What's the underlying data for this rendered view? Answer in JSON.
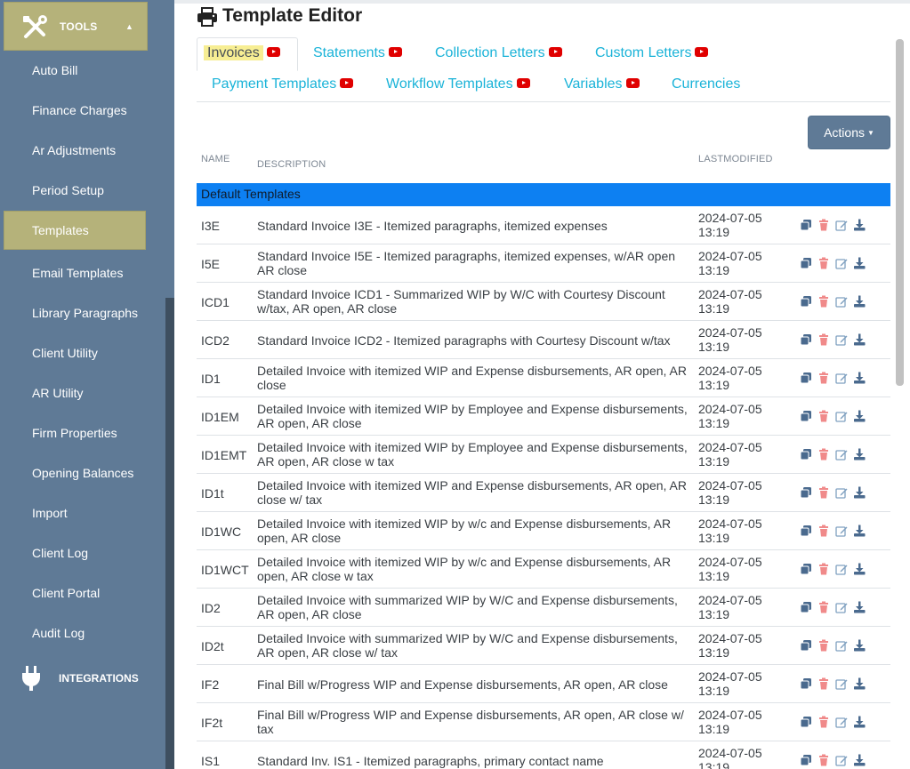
{
  "sidebar": {
    "tools_label": "TOOLS",
    "items": [
      {
        "label": "Auto Bill"
      },
      {
        "label": "Finance Charges"
      },
      {
        "label": "Ar Adjustments"
      },
      {
        "label": "Period Setup"
      },
      {
        "label": "Templates",
        "active": true
      },
      {
        "label": "Email Templates"
      },
      {
        "label": "Library Paragraphs"
      },
      {
        "label": "Client Utility"
      },
      {
        "label": "AR Utility"
      },
      {
        "label": "Firm Properties"
      },
      {
        "label": "Opening Balances"
      },
      {
        "label": "Import"
      },
      {
        "label": "Client Log"
      },
      {
        "label": "Client Portal"
      },
      {
        "label": "Audit Log"
      }
    ],
    "integrations_label": "INTEGRATIONS"
  },
  "page": {
    "title": "Template Editor"
  },
  "tabs": [
    {
      "label": "Invoices",
      "video": true,
      "active": true
    },
    {
      "label": "Statements",
      "video": true
    },
    {
      "label": "Collection Letters",
      "video": true
    },
    {
      "label": "Custom Letters",
      "video": true
    },
    {
      "label": "Payment Templates",
      "video": true
    },
    {
      "label": "Workflow Templates",
      "video": true
    },
    {
      "label": "Variables",
      "video": true
    },
    {
      "label": "Currencies",
      "video": false
    }
  ],
  "actions_label": "Actions",
  "table": {
    "headers": {
      "name": "NAME",
      "description": "DESCRIPTION",
      "modified": "LASTMODIFIED"
    },
    "group_label": "Default Templates",
    "rows": [
      {
        "name": "I3E",
        "description": "Standard Invoice I3E - Itemized paragraphs, itemized expenses",
        "date": "2024-07-05",
        "time": "13:19"
      },
      {
        "name": "I5E",
        "description": "Standard Invoice I5E - Itemized paragraphs, itemized expenses, w/AR open AR close",
        "date": "2024-07-05",
        "time": "13:19"
      },
      {
        "name": "ICD1",
        "description": "Standard Invoice ICD1 - Summarized WIP by W/C with Courtesy Discount w/tax, AR open, AR close",
        "date": "2024-07-05",
        "time": "13:19"
      },
      {
        "name": "ICD2",
        "description": "Standard Invoice ICD2 - Itemized paragraphs with Courtesy Discount w/tax",
        "date": "2024-07-05",
        "time": "13:19"
      },
      {
        "name": "ID1",
        "description": "Detailed Invoice with itemized WIP and Expense disbursements, AR open, AR close",
        "date": "2024-07-05",
        "time": "13:19"
      },
      {
        "name": "ID1EM",
        "description": "Detailed Invoice with itemized WIP by Employee and Expense disbursements, AR open, AR close",
        "date": "2024-07-05",
        "time": "13:19"
      },
      {
        "name": "ID1EMT",
        "description": "Detailed Invoice with itemized WIP by Employee and Expense disbursements, AR open, AR close w tax",
        "date": "2024-07-05",
        "time": "13:19"
      },
      {
        "name": "ID1t",
        "description": "Detailed Invoice with itemized WIP and Expense disbursements, AR open, AR close w/ tax",
        "date": "2024-07-05",
        "time": "13:19"
      },
      {
        "name": "ID1WC",
        "description": "Detailed Invoice with itemized WIP by w/c and Expense disbursements, AR open, AR close",
        "date": "2024-07-05",
        "time": "13:19"
      },
      {
        "name": "ID1WCT",
        "description": "Detailed Invoice with itemized WIP by w/c and Expense disbursements, AR open, AR close w tax",
        "date": "2024-07-05",
        "time": "13:19"
      },
      {
        "name": "ID2",
        "description": "Detailed Invoice with summarized WIP by W/C and Expense disbursements, AR open, AR close",
        "date": "2024-07-05",
        "time": "13:19"
      },
      {
        "name": "ID2t",
        "description": "Detailed Invoice with summarized WIP by W/C and Expense disbursements, AR open, AR close w/ tax",
        "date": "2024-07-05",
        "time": "13:19"
      },
      {
        "name": "IF2",
        "description": "Final Bill w/Progress WIP and Expense disbursements, AR open, AR close",
        "date": "2024-07-05",
        "time": "13:19"
      },
      {
        "name": "IF2t",
        "description": "Final Bill w/Progress WIP and Expense disbursements, AR open, AR close w/ tax",
        "date": "2024-07-05",
        "time": "13:19"
      },
      {
        "name": "IS1",
        "description": "Standard Inv. IS1 - Itemized paragraphs, primary contact name",
        "date": "2024-07-05",
        "time": "13:19"
      }
    ]
  },
  "icons": {
    "row_actions": [
      "copy-icon",
      "trash-icon",
      "edit-icon",
      "download-icon"
    ],
    "tools": "tools-icon",
    "integrations": "plug-icon",
    "title": "printer-icon",
    "video": "youtube-icon"
  },
  "colors": {
    "sidebar_bg": "#5f7a96",
    "active_highlight": "#b5b27a",
    "tab_link": "#1ab3d8",
    "group_row": "#0d80f2",
    "video_badge": "#e00000",
    "icon_blue": "#4a6a8e",
    "trash_icon": "#f08a8a"
  }
}
